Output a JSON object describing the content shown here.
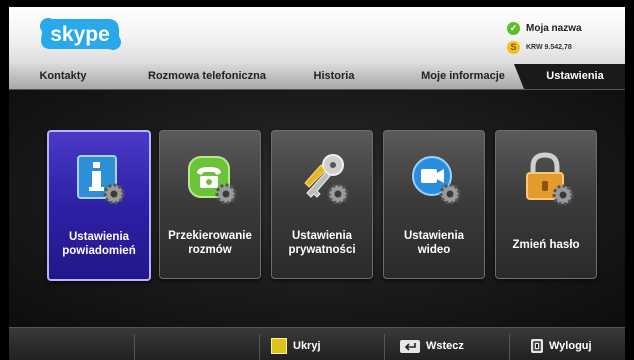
{
  "app": {
    "logo_text": "skype"
  },
  "user": {
    "name": "Moja nazwa",
    "balance": "KRW 9.542,78",
    "status_icon": "online-check-icon",
    "credit_icon": "credit-coin-icon"
  },
  "tabs": [
    {
      "label": "Kontakty"
    },
    {
      "label": "Rozmowa telefoniczna"
    },
    {
      "label": "Historia"
    },
    {
      "label": "Moje informacje"
    },
    {
      "label": "Ustawienia",
      "active": true
    }
  ],
  "tiles": [
    {
      "label": "Ustawienia\npowiadomień",
      "icon": "info-settings-icon",
      "selected": true
    },
    {
      "label": "Przekierowanie\nrozmów",
      "icon": "phone-forward-icon"
    },
    {
      "label": "Ustawienia\nprywatności",
      "icon": "key-privacy-icon"
    },
    {
      "label": "Ustawienia\nwideo",
      "icon": "video-camera-icon"
    },
    {
      "label": "Zmień hasło",
      "icon": "padlock-icon"
    }
  ],
  "footer": {
    "hide_label": "Ukryj",
    "back_label": "Wstecz",
    "logout_label": "Wyloguj"
  },
  "colors": {
    "accent": "#3324b0",
    "selected_border": "#b9b2ff",
    "skype_blue": "#22a6e6",
    "yellow_key": "#e0c21a"
  }
}
